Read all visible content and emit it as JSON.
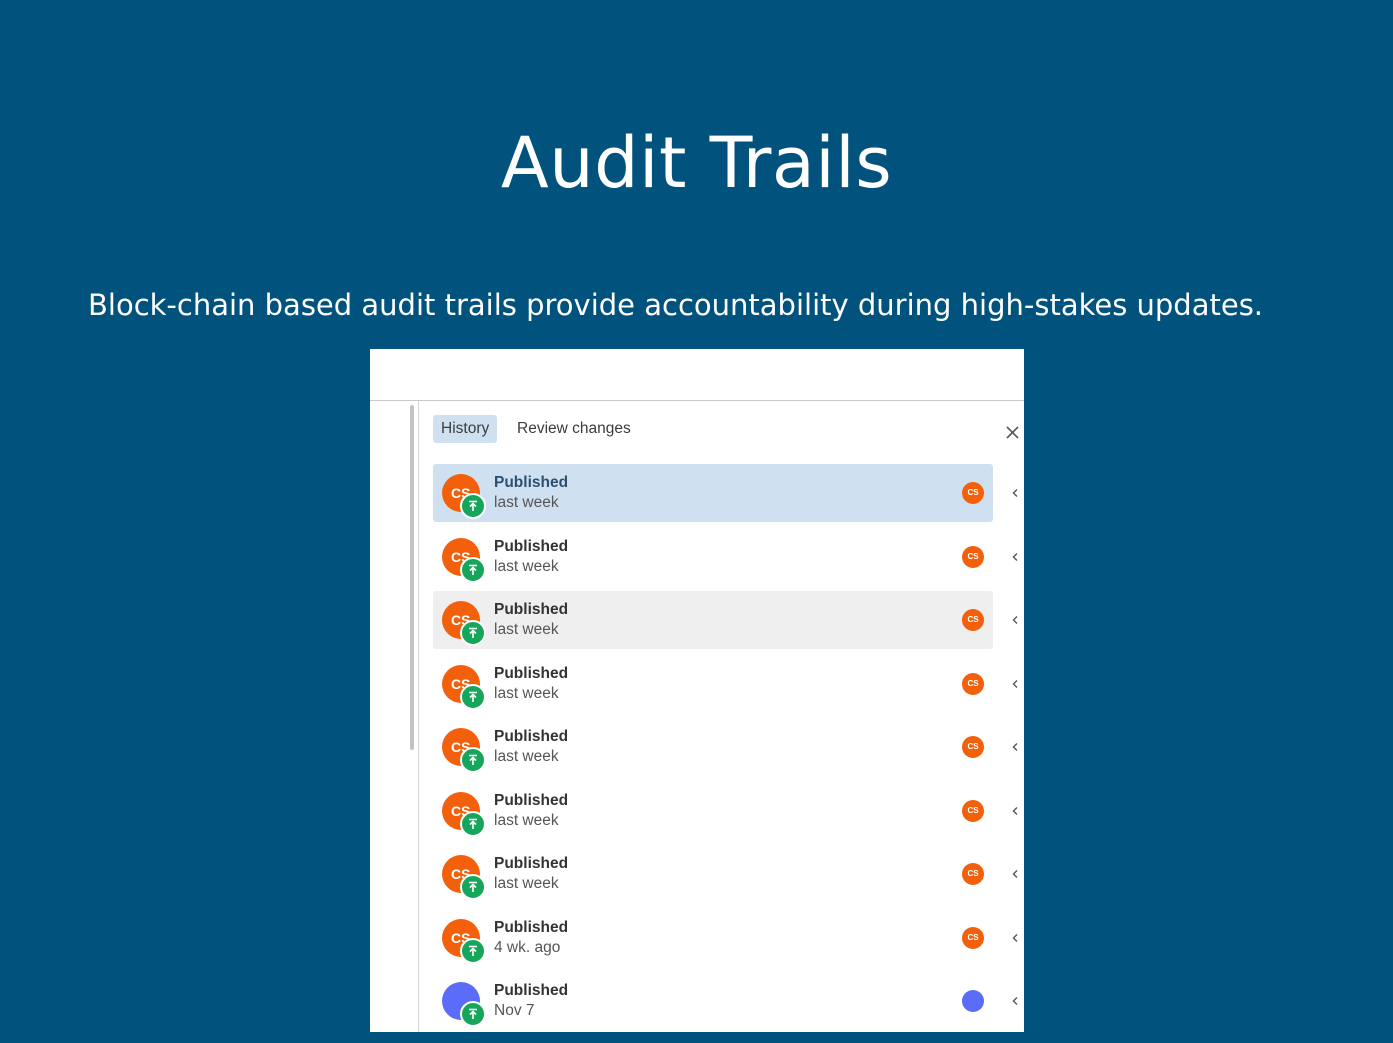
{
  "slide": {
    "title": "Audit Trails",
    "subtitle": "Block-chain based audit trails provide accountability during high-stakes updates."
  },
  "colors": {
    "background": "#01527D",
    "avatar_orange": "#F2600C",
    "avatar_blue": "#5B6CF9",
    "publish_green": "#15A65B",
    "selected_row": "#CFE1F0",
    "hovered_row": "#EFEFEF"
  },
  "panel": {
    "tabs": [
      {
        "label": "History",
        "active": true
      },
      {
        "label": "Review changes",
        "active": false
      }
    ],
    "close_icon": "close-icon",
    "history": [
      {
        "title": "Published",
        "time": "last week",
        "initials": "CS",
        "mini_initials": "CS",
        "avatar_color": "#F2600C",
        "state": "selected"
      },
      {
        "title": "Published",
        "time": "last week",
        "initials": "CS",
        "mini_initials": "CS",
        "avatar_color": "#F2600C",
        "state": "normal"
      },
      {
        "title": "Published",
        "time": "last week",
        "initials": "CS",
        "mini_initials": "CS",
        "avatar_color": "#F2600C",
        "state": "hovered"
      },
      {
        "title": "Published",
        "time": "last week",
        "initials": "CS",
        "mini_initials": "CS",
        "avatar_color": "#F2600C",
        "state": "normal"
      },
      {
        "title": "Published",
        "time": "last week",
        "initials": "CS",
        "mini_initials": "CS",
        "avatar_color": "#F2600C",
        "state": "normal"
      },
      {
        "title": "Published",
        "time": "last week",
        "initials": "CS",
        "mini_initials": "CS",
        "avatar_color": "#F2600C",
        "state": "normal"
      },
      {
        "title": "Published",
        "time": "last week",
        "initials": "CS",
        "mini_initials": "CS",
        "avatar_color": "#F2600C",
        "state": "normal"
      },
      {
        "title": "Published",
        "time": "4 wk. ago",
        "initials": "CS",
        "mini_initials": "CS",
        "avatar_color": "#F2600C",
        "state": "normal"
      },
      {
        "title": "Published",
        "time": "Nov 7",
        "initials": "",
        "mini_initials": "",
        "avatar_color": "#5B6CF9",
        "state": "normal"
      }
    ]
  }
}
